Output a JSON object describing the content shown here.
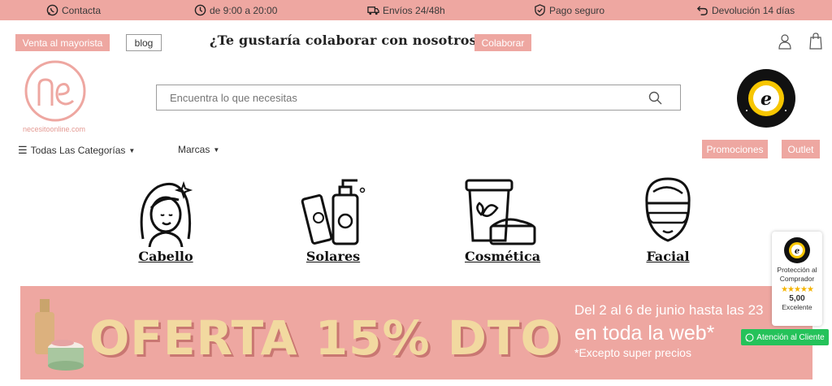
{
  "topbar": {
    "contact": "Contacta",
    "hours": "de 9:00 a 20:00",
    "shipping": "Envíos 24/48h",
    "payment": "Pago seguro",
    "returns": "Devolución 14 días"
  },
  "header": {
    "wholesale_label": "Venta al mayorista",
    "blog_label": "blog",
    "collab_question": "¿Te gustaría colaborar con nosotros?",
    "collab_button": "Colaborar",
    "logo_text": "necesitoonline.com"
  },
  "search": {
    "placeholder": "Encuentra lo que necesitas"
  },
  "nav": {
    "all_categories": "Todas Las Categorías",
    "brands": "Marcas",
    "promotions": "Promociones",
    "outlet": "Outlet"
  },
  "categories": [
    {
      "label": "Cabello"
    },
    {
      "label": "Solares"
    },
    {
      "label": "Cosmética"
    },
    {
      "label": "Facial"
    }
  ],
  "banner": {
    "headline": "OFERTA 15% DTO",
    "dates": "Del 2 al 6 de junio hasta las 23",
    "web": "en toda la web*",
    "note": "*Excepto super precios"
  },
  "widget": {
    "protection": "Protección al Comprador",
    "rating": "5,00",
    "rating_label": "Excelente",
    "stars": "★★★★★"
  },
  "whatsapp": {
    "label": "Atención al Cliente"
  },
  "colors": {
    "brand_pink": "#eea7a1",
    "whatsapp_green": "#25c25a",
    "banner_text": "#f2d9a0"
  }
}
